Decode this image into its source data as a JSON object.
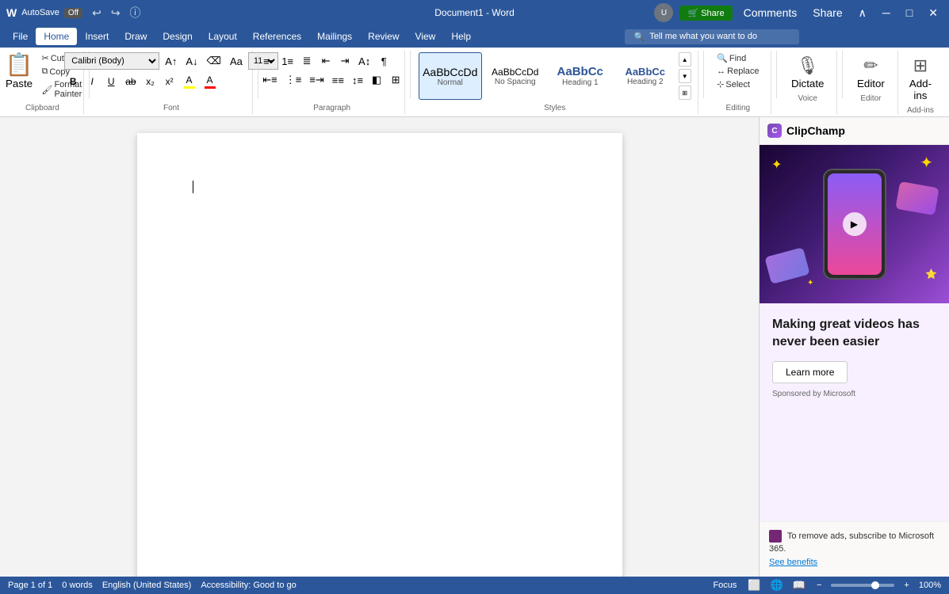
{
  "titleBar": {
    "appName": "Word",
    "autoSave": "AutoSave",
    "autoSaveStatus": "Off",
    "docTitle": "Document1 - Word",
    "undoTooltip": "Undo",
    "redoTooltip": "Redo",
    "shareLabel": "Share",
    "commentsLabel": "Comments"
  },
  "menuBar": {
    "items": [
      "File",
      "Home",
      "Insert",
      "Draw",
      "Design",
      "Layout",
      "References",
      "Mailings",
      "Review",
      "View",
      "Help"
    ],
    "activeItem": "Home",
    "searchPlaceholder": "Tell me what you want to do"
  },
  "ribbon": {
    "clipboard": {
      "label": "Clipboard",
      "paste": "Paste",
      "copyLabel": "Copy",
      "cutLabel": "Cut",
      "formatPainterLabel": "Format Painter"
    },
    "font": {
      "label": "Font",
      "fontFamily": "Calibri (Body)",
      "fontSize": "11",
      "bold": "B",
      "italic": "I",
      "underline": "U",
      "strikethrough": "S",
      "subscript": "x₂",
      "superscript": "x²",
      "highlightColor": "#ffff00",
      "fontColor": "#ff0000"
    },
    "paragraph": {
      "label": "Paragraph"
    },
    "styles": {
      "label": "Styles",
      "items": [
        {
          "name": "Normal",
          "preview": "AaBbCcDd",
          "labelText": "Normal",
          "selected": true
        },
        {
          "name": "No Spacing",
          "preview": "AaBbCcDd",
          "labelText": "No Spacing",
          "selected": false
        },
        {
          "name": "Heading 1",
          "preview": "AaBbCc",
          "labelText": "Heading 1",
          "selected": false
        },
        {
          "name": "Heading 2",
          "preview": "AaBbCc",
          "labelText": "Heading 2",
          "selected": false
        }
      ]
    },
    "editing": {
      "label": "Editing",
      "find": "Find",
      "replace": "Replace",
      "select": "Select"
    },
    "voice": {
      "label": "Voice",
      "dictate": "Dictate"
    },
    "editor": {
      "label": "Editor",
      "editorBtn": "Editor"
    },
    "addins": {
      "label": "Add-ins",
      "addinsBtn": "Add-ins"
    }
  },
  "document": {
    "content": ""
  },
  "sidePanel": {
    "logoText": "ClipChamp",
    "adHeadline": "Making great videos has never been easier",
    "learnMoreBtn": "Learn more",
    "sponsoredText": "Sponsored by Microsoft",
    "footerText": "To remove ads, subscribe to Microsoft 365.",
    "seeBenefits": "See benefits"
  },
  "statusBar": {
    "pageInfo": "Page 1 of 1",
    "wordCount": "0 words",
    "language": "English (United States)",
    "accessibility": "Accessibility: Good to go",
    "focusBtn": "Focus",
    "zoom": "100%"
  }
}
